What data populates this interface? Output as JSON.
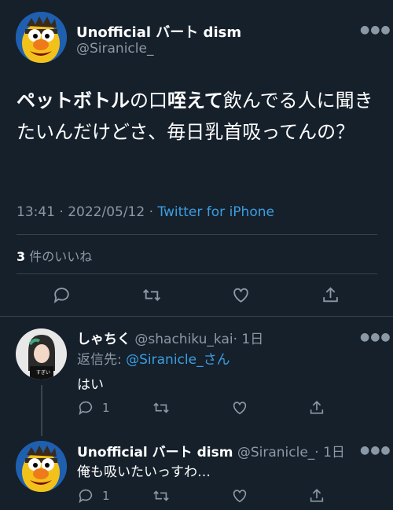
{
  "colors": {
    "background": "#15202b",
    "muted": "#8b98a5",
    "link": "#3d9de0",
    "divider": "#38444d"
  },
  "main_tweet": {
    "display_name": "Unofficial バート dism",
    "handle": "@Siranicle_",
    "text_bold1": "ペットボトル",
    "text_part1": "の口",
    "text_bold2": "咥えて",
    "text_part2": "飲んでる人に聞きたいんだけどさ、毎日乳首吸ってんの？",
    "time_date": "13:41 · 2022/05/12 · ",
    "source": "Twitter for iPhone",
    "likes_count": "3",
    "likes_label": " 件のいいね",
    "icons": [
      "reply-icon",
      "retweet-icon",
      "like-icon",
      "share-icon"
    ]
  },
  "reply1": {
    "display_name": "しゃちく",
    "handle": "@shachiku_kai",
    "time": "· 1日",
    "replying_label": "返信先: ",
    "replying_to": "@Siranicle_さん",
    "text": "はい",
    "reply_count": "1"
  },
  "reply2": {
    "display_name": "Unofficial バート dism",
    "handle": "@Siranicle_",
    "time": "· 1日",
    "text": "俺も吸いたいっすわ…",
    "reply_count": "1"
  }
}
